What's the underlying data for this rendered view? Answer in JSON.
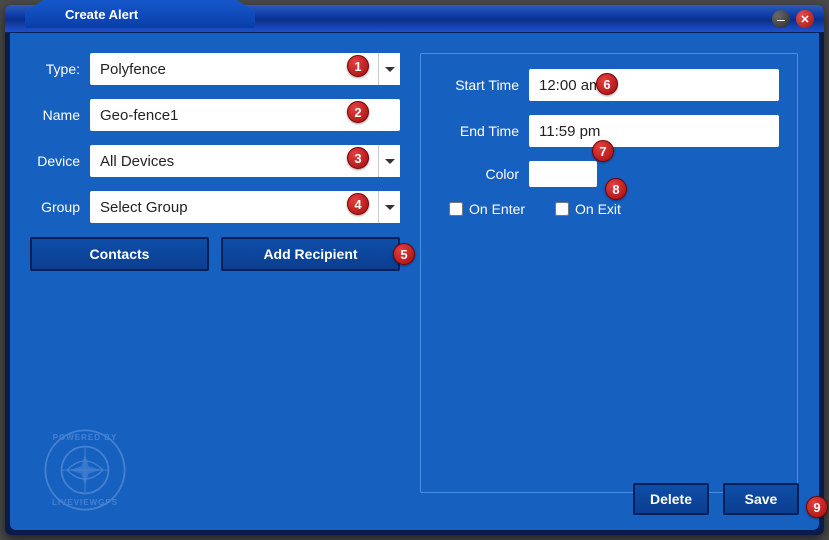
{
  "window": {
    "title": "Create Alert"
  },
  "left": {
    "type_label": "Type:",
    "type_value": "Polyfence",
    "name_label": "Name",
    "name_value": "Geo-fence1",
    "device_label": "Device",
    "device_value": "All Devices",
    "group_label": "Group",
    "group_value": "Select Group",
    "contacts_btn": "Contacts",
    "add_recipient_btn": "Add Recipient"
  },
  "right": {
    "start_label": "Start Time",
    "start_value": "12:00 am",
    "end_label": "End Time",
    "end_value": "11:59 pm",
    "color_label": "Color",
    "color_value": "",
    "on_enter": "On Enter",
    "on_exit": "On Exit"
  },
  "bottom": {
    "delete": "Delete",
    "save": "Save"
  },
  "logo": {
    "top": "POWERED BY",
    "bottom": "LIVEVIEWGPS"
  },
  "badges": [
    "1",
    "2",
    "3",
    "4",
    "5",
    "6",
    "7",
    "8",
    "9"
  ]
}
